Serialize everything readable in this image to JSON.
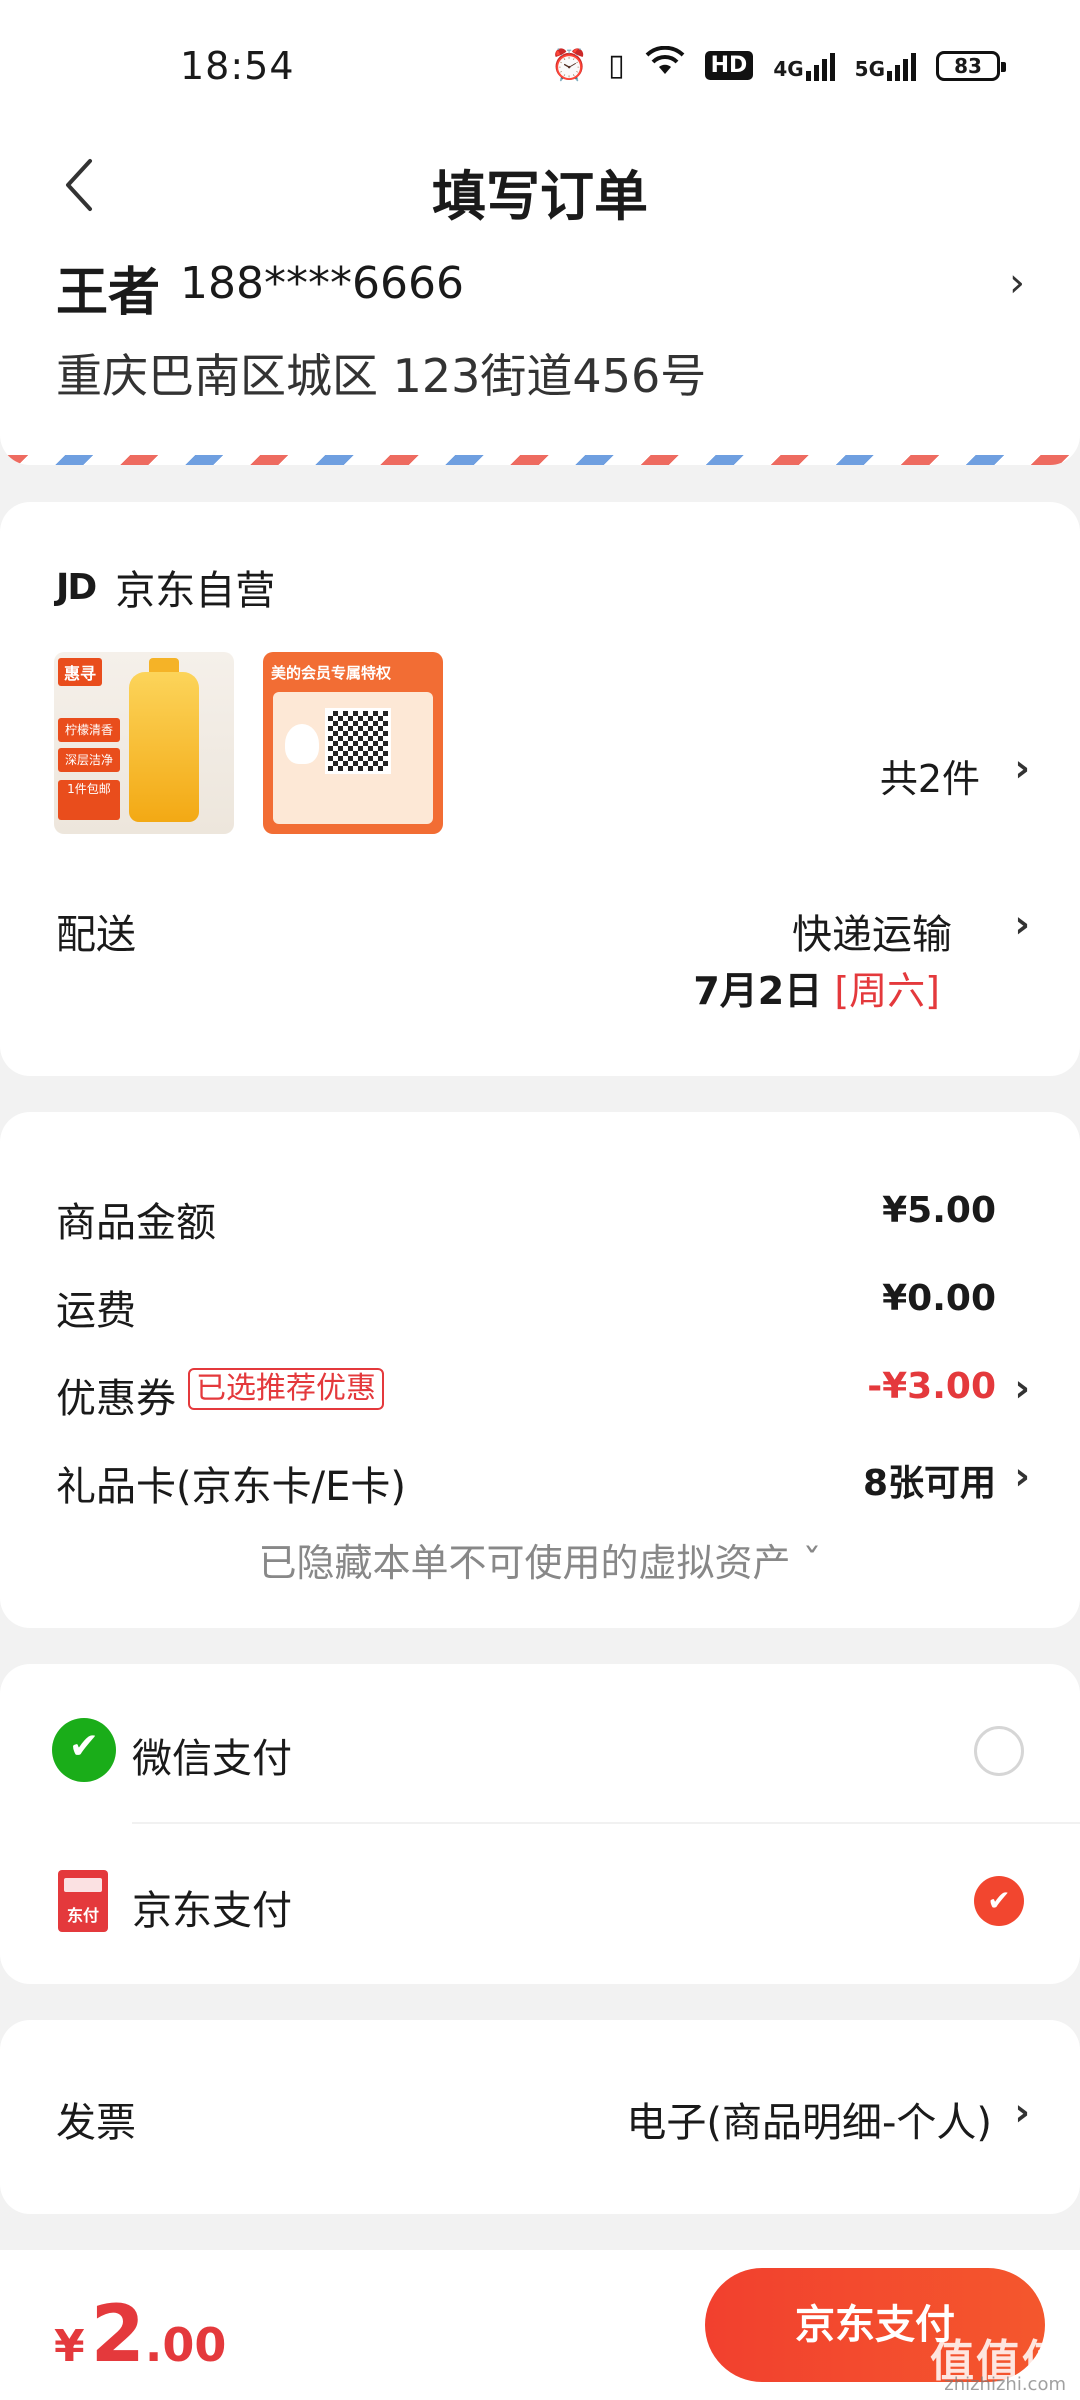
{
  "status_bar": {
    "time": "18:54",
    "icons": [
      "alarm-icon",
      "vibrate-icon",
      "wifi-icon",
      "hd-icon",
      "signal-4g-icon",
      "signal-5g-icon"
    ],
    "hd": "HD",
    "net1": "4G",
    "net2": "5G",
    "battery": "83"
  },
  "header": {
    "title": "填写订单",
    "back_icon": "back-arrow-icon"
  },
  "address": {
    "name": "王者",
    "phone": "188****6666",
    "line": "重庆巴南区城区 123街道456号"
  },
  "shop": {
    "logo": "JD",
    "name": "京东自营",
    "thumb1_brand": "惠寻",
    "thumb1_tags": [
      "柠檬清香",
      "深层洁净",
      "1件包邮"
    ],
    "thumb2_title": "美的会员专属特权",
    "count_label": "共2件",
    "shipping_label": "配送",
    "shipping_value": "快递运输",
    "shipping_date": "7月2日",
    "shipping_weekday": "[周六]"
  },
  "price": {
    "goods_label": "商品金额",
    "goods_value": "¥5.00",
    "freight_label": "运费",
    "freight_value": "¥0.00",
    "coupon_label": "优惠券",
    "coupon_tag": "已选推荐优惠",
    "coupon_value": "-¥3.00",
    "giftcard_label": "礼品卡(京东卡/E卡)",
    "giftcard_value": "8张可用",
    "hidden_note": "已隐藏本单不可使用的虚拟资产 ˇ"
  },
  "payment": {
    "options": [
      {
        "label": "微信支付",
        "icon": "wechat-pay-icon",
        "selected": false
      },
      {
        "label": "京东支付",
        "icon": "jd-pay-icon",
        "selected": true
      }
    ],
    "jd_icon_text": "东付"
  },
  "invoice": {
    "label": "发票",
    "value": "电子(商品明细-个人)"
  },
  "footer": {
    "currency": "¥",
    "total_int": "2",
    "total_dec": ".00",
    "pay_button": "京东支付",
    "watermark": "值值值",
    "watermark_sub": "zhizhizhi.com"
  },
  "colors": {
    "accent": "#e4393c",
    "button": "#f2402e",
    "wechat": "#1aad19"
  }
}
